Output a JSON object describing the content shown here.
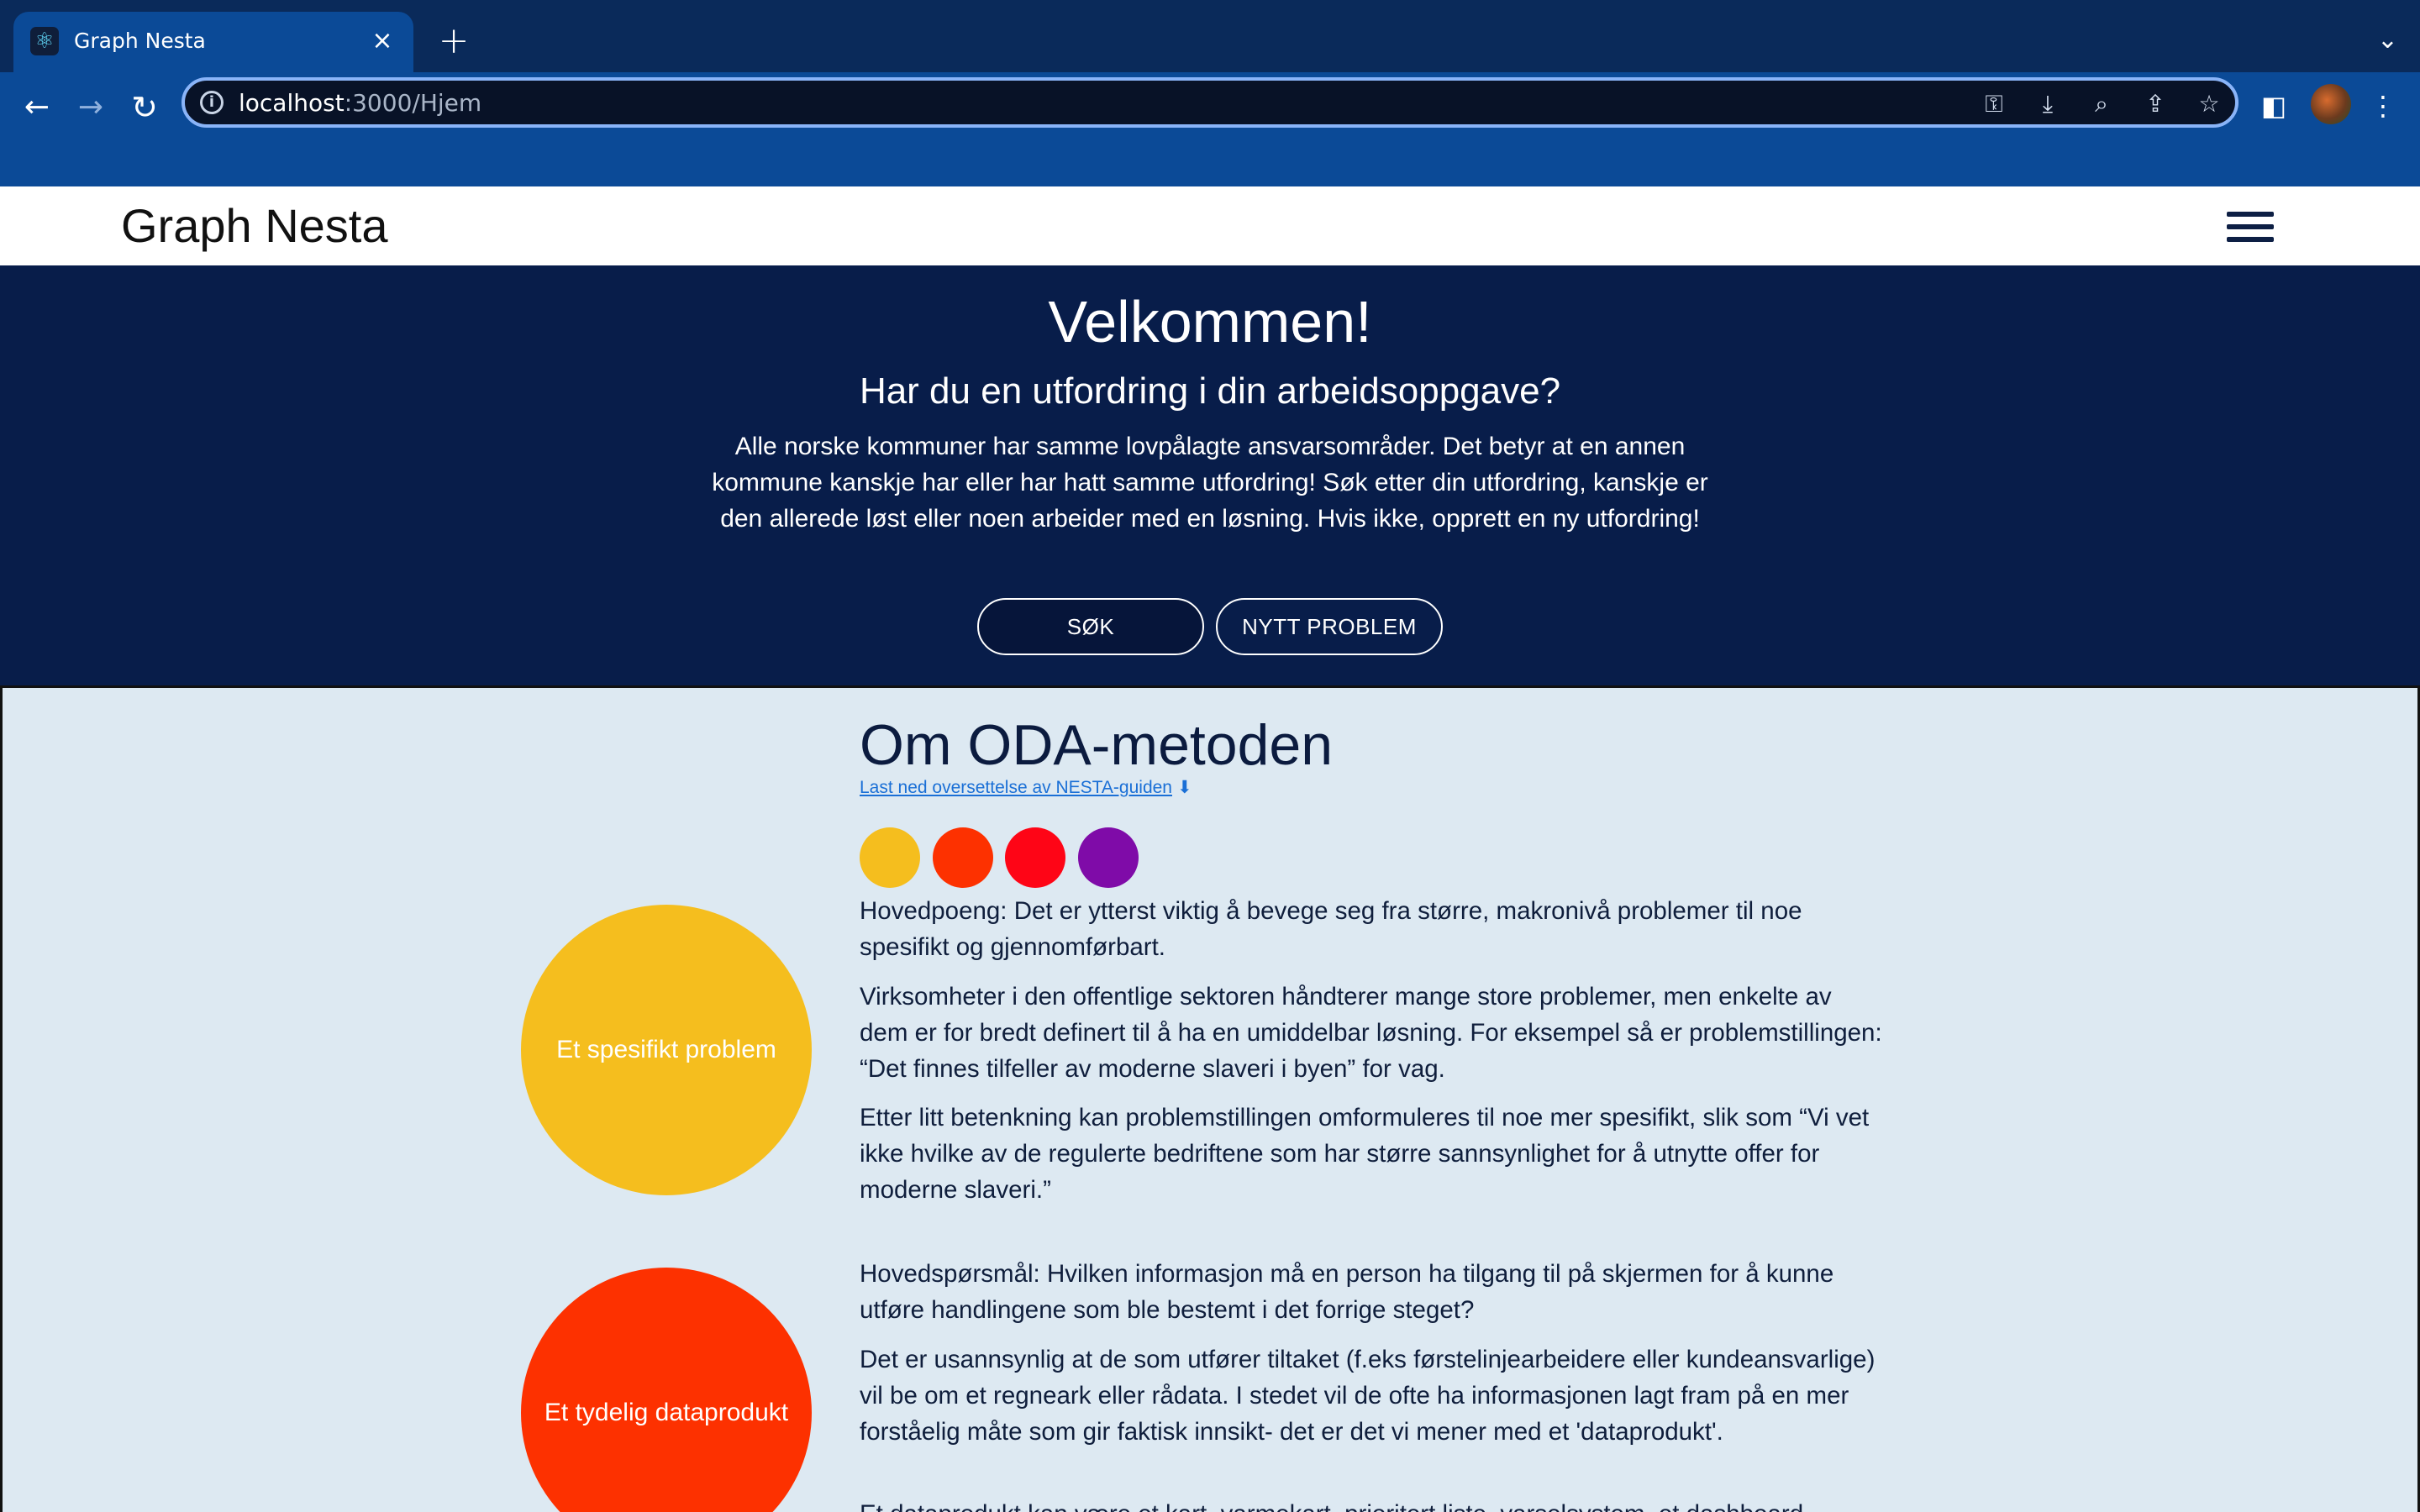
{
  "browser": {
    "tab_title": "Graph Nesta",
    "tab_close": "×",
    "new_tab": "+",
    "tabs_menu": "⌄",
    "url_host": "localhost",
    "url_rest": ":3000/Hjem",
    "back": "←",
    "forward": "→",
    "reload": "↻",
    "omni_icons": {
      "key": "⚿",
      "install": "⤓",
      "zoom": "⌕",
      "share": "⇪",
      "bookmark": "☆"
    },
    "sidepanel": "◧",
    "menu": "⋮",
    "info": "i"
  },
  "header": {
    "brand": "Graph Nesta"
  },
  "hero": {
    "title": "Velkommen!",
    "subtitle": "Har du en utfordring i din arbeidsoppgave?",
    "text": "Alle norske kommuner har samme lovpålagte ansvarsområder. Det betyr at en annen kommune kanskje har eller har hatt samme utfordring! Søk etter din utfordring, kanskje er den allerede løst eller noen arbeider med en løsning. Hvis ikke, opprett en ny utfordring!",
    "search_button": "SØK",
    "new_button": "NYTT PROBLEM"
  },
  "oda": {
    "title": "Om ODA-metoden",
    "download_link": "Last ned oversettelse av NESTA-guiden",
    "download_icon": "⬇",
    "colors": [
      "#f5be1e",
      "#fd3100",
      "#fe0516",
      "#7f0ba8"
    ],
    "sections": [
      {
        "circle_label": "Et spesifikt problem",
        "paragraphs": [
          "Hovedpoeng: Det er ytterst viktig å bevege seg fra større, makronivå problemer til noe spesifikt og gjennomførbart.",
          "Virksomheter i den offentlige sektoren håndterer mange store problemer, men enkelte av dem er for bredt definert til å ha en umiddelbar løsning. For eksempel så er problemstillingen: “Det finnes tilfeller av moderne slaveri i byen” for vag.",
          "Etter litt betenkning kan problemstillingen omformuleres til noe mer spesifikt, slik som “Vi vet ikke hvilke av de regulerte bedriftene som har større sannsynlighet for å utnytte offer for moderne slaveri.”"
        ]
      },
      {
        "circle_label": "Et tydelig dataprodukt",
        "paragraphs": [
          "Hovedspørsmål: Hvilken informasjon må en person ha tilgang til på skjermen for å kunne utføre handlingene som ble bestemt i det forrige steget?",
          "Det er usannsynlig at de som utfører tiltaket (f.eks førstelinjearbeidere eller kundeansvarlige) vil be om et regneark eller rådata. I stedet vil de ofte ha informasjonen lagt fram på en mer forståelig måte som gir faktisk innsikt- det er det vi mener med et 'dataprodukt'.",
          "Et dataprodukt kan være et kart, varmekart, prioritert liste, varselsystem, et dashboard"
        ]
      }
    ]
  }
}
